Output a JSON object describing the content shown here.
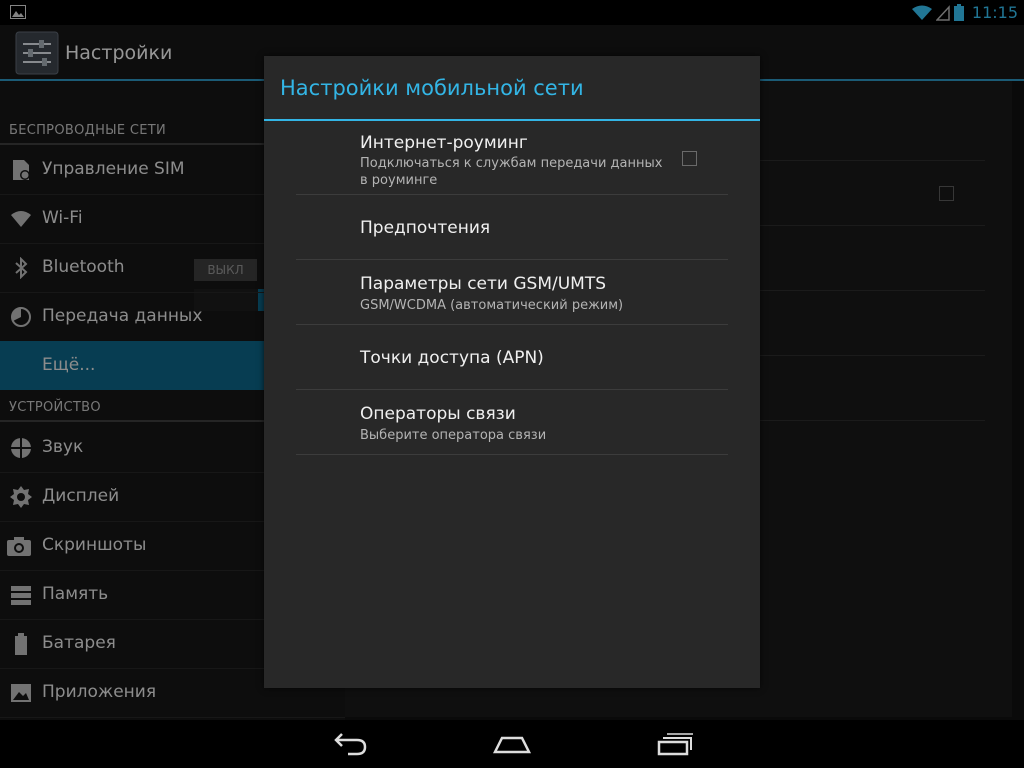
{
  "status_bar": {
    "time": "11:15"
  },
  "action_bar": {
    "title": "Настройки"
  },
  "left_list": {
    "sections": [
      {
        "header": "БЕСПРОВОДНЫЕ СЕТИ",
        "items": [
          {
            "label": "Управление SIM",
            "icon": "sim-icon"
          },
          {
            "label": "Wi-Fi",
            "icon": "wifi-icon"
          },
          {
            "label": "Bluetooth",
            "icon": "bluetooth-icon",
            "toggle": "ВЫКЛ"
          },
          {
            "label": "Передача данных",
            "icon": "data-usage-icon"
          },
          {
            "label": "Ещё...",
            "icon": "",
            "selected": true
          }
        ]
      },
      {
        "header": "УСТРОЙСТВО",
        "items": [
          {
            "label": "Звук",
            "icon": "sound-icon"
          },
          {
            "label": "Дисплей",
            "icon": "display-icon"
          },
          {
            "label": "Скриншоты",
            "icon": "camera-icon"
          },
          {
            "label": "Память",
            "icon": "storage-icon"
          },
          {
            "label": "Батарея",
            "icon": "battery-icon"
          },
          {
            "label": "Приложения",
            "icon": "apps-icon"
          }
        ]
      }
    ]
  },
  "dialog": {
    "title": "Настройки мобильной сети",
    "items": [
      {
        "title": "Интернет-роуминг",
        "summary_lines": [
          "Подключаться к службам передачи данных",
          "в роуминге"
        ],
        "checkbox": false
      },
      {
        "title": "Предпочтения"
      },
      {
        "title": "Параметры сети GSM/UMTS",
        "summary_lines": [
          "GSM/WCDMA (автоматический режим)"
        ]
      },
      {
        "title": "Точки доступа (APN)"
      },
      {
        "title": "Операторы связи",
        "summary_lines": [
          "Выберите оператора связи"
        ]
      }
    ]
  },
  "colors": {
    "accent": "#33b5e5",
    "selected": "#0b5f7e",
    "dialog_bg": "#282828"
  },
  "nav_bar": {
    "icons": [
      "back-icon",
      "home-icon",
      "recent-apps-icon"
    ]
  }
}
